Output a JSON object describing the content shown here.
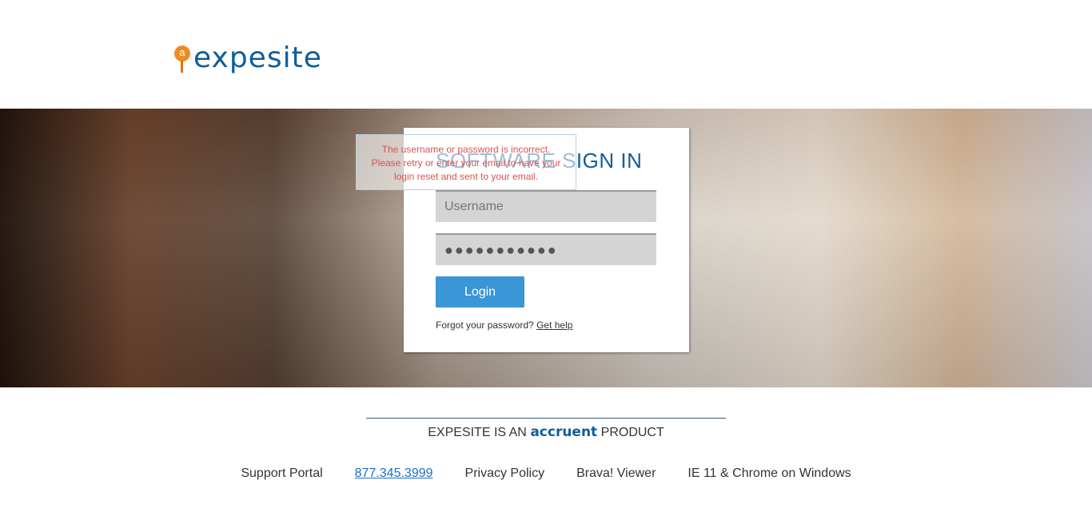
{
  "logo": {
    "letter": "a",
    "text": "expesite"
  },
  "signin": {
    "title": "SOFTWARE SIGN IN",
    "username_placeholder": "Username",
    "password_value": "●●●●●●●●●●●",
    "login_label": "Login",
    "forgot_text": "Forgot your password?",
    "get_help": "Get help"
  },
  "error": {
    "lines": [
      "The username or password is incorrect.",
      "Please retry or enter your email to have your",
      "login reset and sent to your email."
    ]
  },
  "product": {
    "prefix": "EXPESITE IS AN",
    "brand": "accruent",
    "suffix": "PRODUCT"
  },
  "footer": {
    "links": [
      "Support Portal",
      "877.345.3999",
      "Privacy Policy",
      "Brava! Viewer",
      "IE 11 & Chrome on Windows"
    ]
  },
  "colors": {
    "brand": "#0f5e9c",
    "accent": "#3a96d6",
    "error": "#d9534f"
  }
}
